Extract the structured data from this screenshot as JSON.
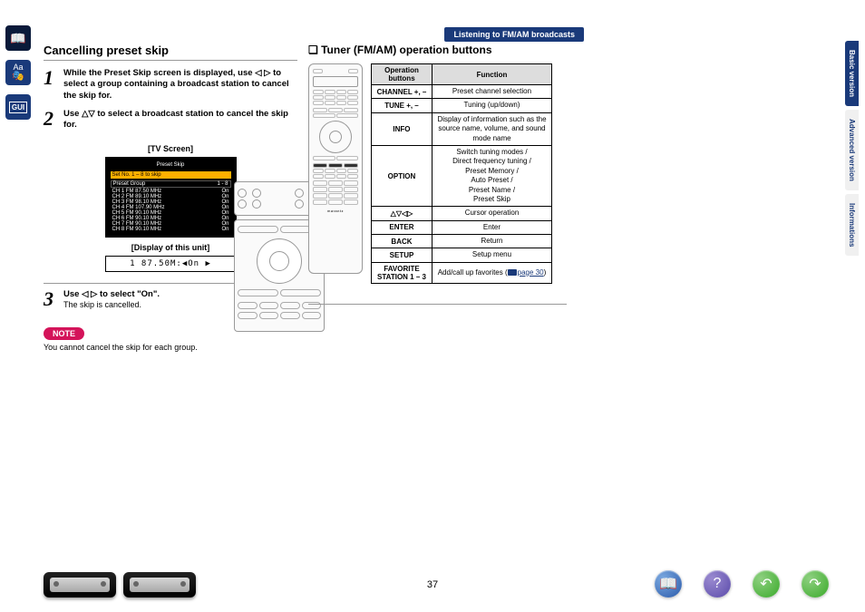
{
  "breadcrumb": "Listening to FM/AM broadcasts",
  "left_nav": [
    "book-icon",
    "font-masks-icon",
    "gui-icon"
  ],
  "gui_text": "GUI",
  "right_tabs": {
    "active": "Basic version",
    "items": [
      "Basic version",
      "Advanced version",
      "Informations"
    ]
  },
  "left_col": {
    "title": "Cancelling preset skip",
    "steps": [
      {
        "num": "1",
        "text": "While the Preset Skip screen is displayed, use ◁ ▷ to select a group containing a broadcast station to cancel the skip for."
      },
      {
        "num": "2",
        "text": "Use △▽ to select a broadcast station to cancel the skip for."
      },
      {
        "num": "3",
        "text": "Use ◁ ▷ to select \"On\".",
        "sub": "The skip is cancelled."
      }
    ],
    "tv_label": "[TV Screen]",
    "tv": {
      "title": "Preset Skip",
      "header": "Set No. 1 – 8 to skip",
      "group_row": [
        "Preset Group",
        "1 - 8"
      ],
      "rows": [
        [
          "CH 1",
          "FM",
          "87.50 MHz",
          "On"
        ],
        [
          "CH 2",
          "FM",
          "89.10 MHz",
          "On"
        ],
        [
          "CH 3",
          "FM",
          "98.10 MHz",
          "On"
        ],
        [
          "CH 4",
          "FM",
          "107.90 MHz",
          "On"
        ],
        [
          "CH 5",
          "FM",
          "90.10 MHz",
          "On"
        ],
        [
          "CH 6",
          "FM",
          "90.10 MHz",
          "On"
        ],
        [
          "CH 7",
          "FM",
          "90.10 MHz",
          "On"
        ],
        [
          "CH 8",
          "FM",
          "90.10 MHz",
          "On"
        ]
      ]
    },
    "unit_label": "[Display of this unit]",
    "unit_text": "1  87.50M:◀On ▶",
    "note_label": "NOTE",
    "note_text": "You cannot cancel the skip for each group."
  },
  "right_col": {
    "title": "❏ Tuner (FM/AM) operation buttons",
    "brand": "marantz",
    "table": {
      "headers": [
        "Operation buttons",
        "Function"
      ],
      "rows": [
        {
          "btn": "CHANNEL +, –",
          "fn": "Preset channel selection"
        },
        {
          "btn": "TUNE +, –",
          "fn": "Tuning (up/down)"
        },
        {
          "btn": "INFO",
          "fn": "Display of information such as the source name, volume, and sound mode name"
        },
        {
          "btn": "OPTION",
          "fn": "Switch tuning modes /\nDirect frequency tuning /\nPreset Memory /\nAuto Preset /\nPreset Name /\nPreset Skip"
        },
        {
          "btn": "△▽◁▷",
          "fn": "Cursor operation"
        },
        {
          "btn": "ENTER",
          "fn": "Enter"
        },
        {
          "btn": "BACK",
          "fn": "Return"
        },
        {
          "btn": "SETUP",
          "fn": "Setup menu"
        },
        {
          "btn": "FAVORITE STATION 1 – 3",
          "fn_prefix": "Add/call up favorites (",
          "fn_link": "page 30",
          "fn_suffix": ")"
        }
      ]
    }
  },
  "page_num": "37"
}
